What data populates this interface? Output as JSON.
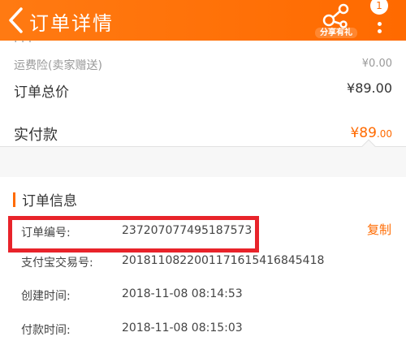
{
  "header": {
    "title": "订单详情",
    "share_label": "分享有礼",
    "badge_count": "1",
    "colors": {
      "bar": "#ff6a00",
      "text": "#ffffff"
    },
    "icons": {
      "back": "back-chevron-icon",
      "share": "share-icon",
      "more": "more-vertical-icon"
    }
  },
  "summary": {
    "partial_label": "...",
    "shipping_insurance_label": "运费险(卖家赠送)",
    "shipping_insurance_value": "¥0.00",
    "total_label": "订单总价",
    "total_value": "¥89.00",
    "paid_label": "实付款",
    "paid_value": "¥89",
    "paid_cents": ".00",
    "accent": "#ff6a00"
  },
  "order_info": {
    "section_title": "订单信息",
    "copy_label": "复制",
    "rows": [
      {
        "label": "订单编号:",
        "value": "237207077495187573"
      },
      {
        "label": "支付宝交易号:",
        "value": "2018110822001171615416845418"
      },
      {
        "label": "创建时间:",
        "value": "2018-11-08 08:14:53"
      },
      {
        "label": "付款时间:",
        "value": "2018-11-08 08:15:03"
      }
    ],
    "highlight_color": "#e8232a"
  }
}
